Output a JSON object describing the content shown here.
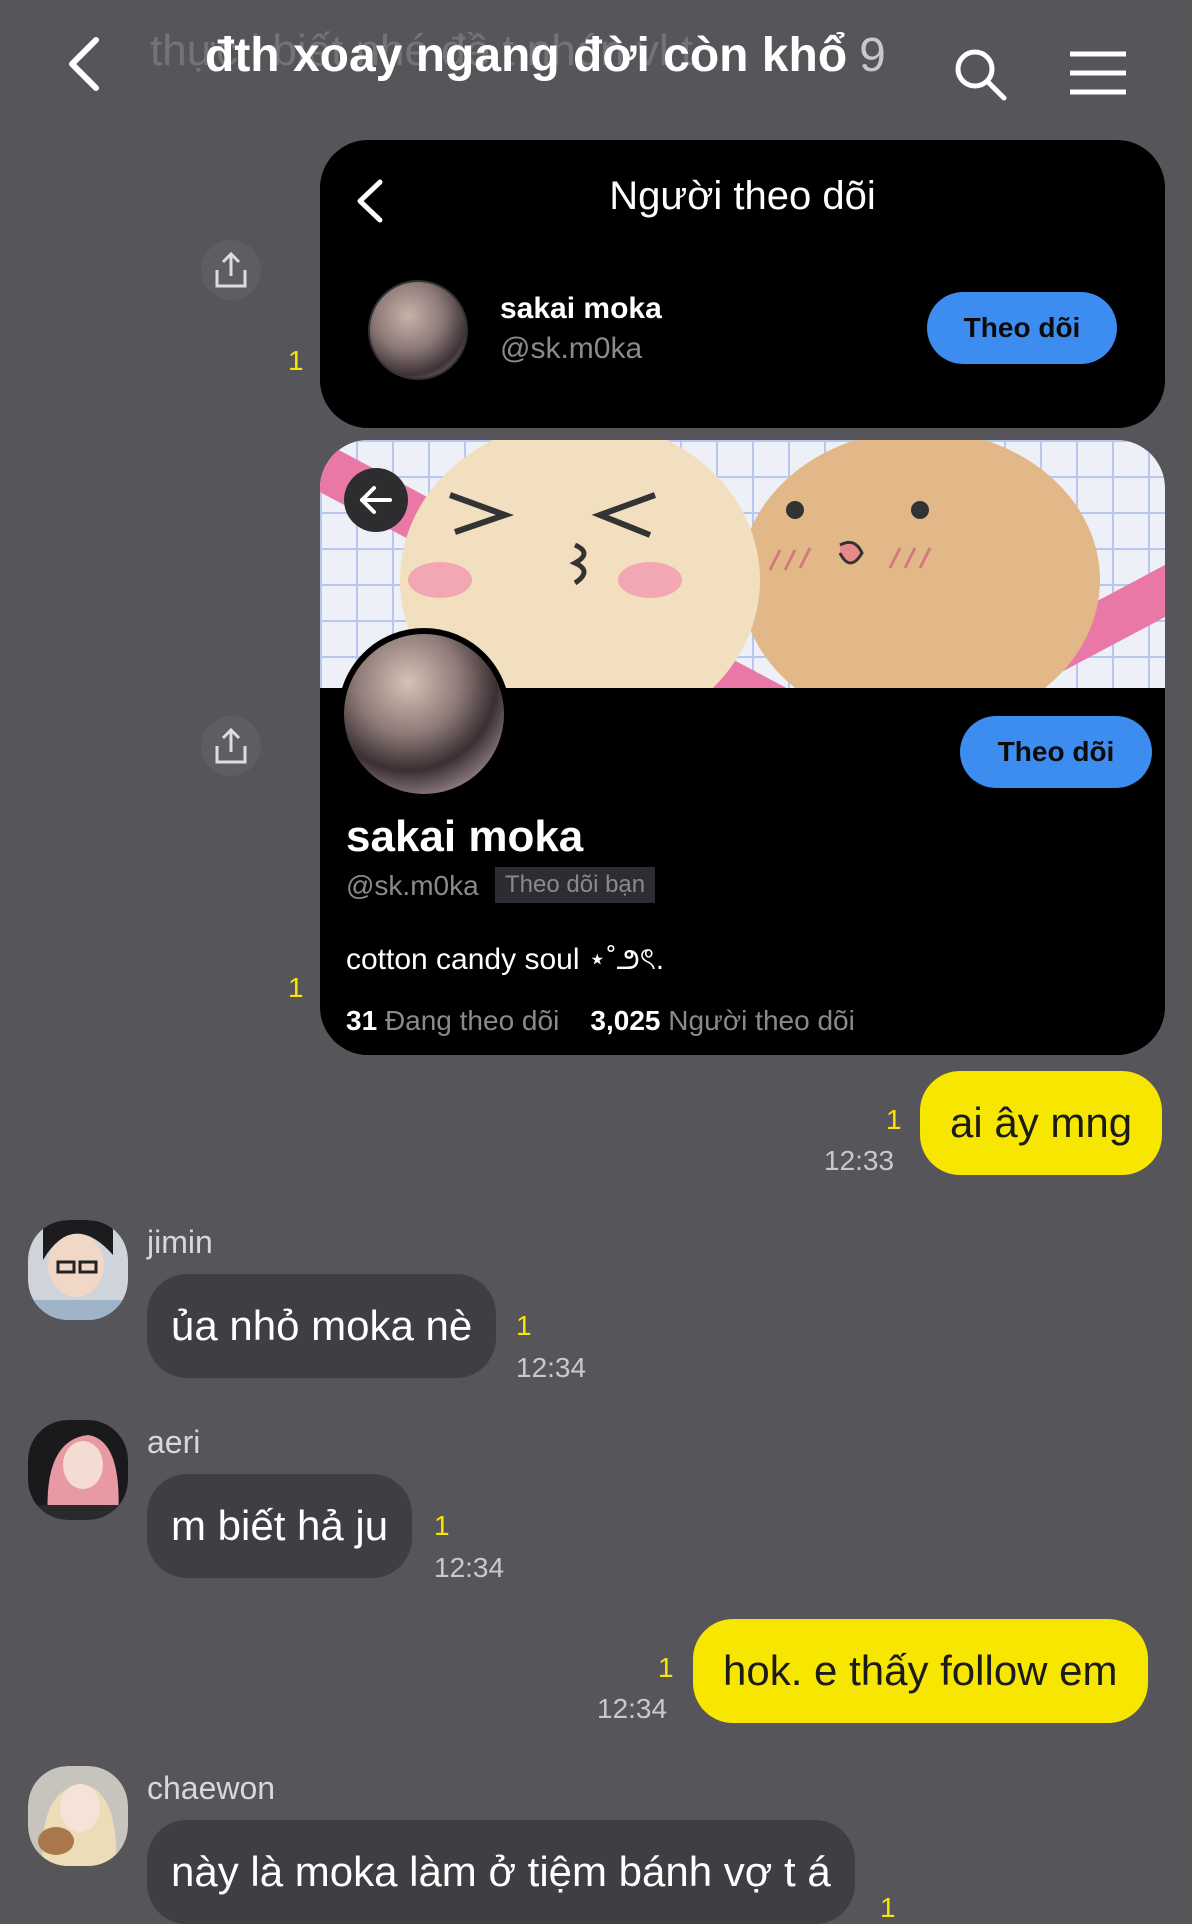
{
  "header": {
    "ghost_text": "thực i biết nhé đề t nhón vl t",
    "title": "đth xoay ngang đời còn khổ",
    "member_count": "9"
  },
  "card_followers": {
    "title": "Người theo dõi",
    "read_count": "1",
    "user": {
      "name": "sakai moka",
      "handle": "@sk.m0ka",
      "follow_label": "Theo dõi"
    }
  },
  "card_profile": {
    "read_count": "1",
    "follow_label": "Theo dõi",
    "name": "sakai moka",
    "handle": "@sk.m0ka",
    "follows_you": "Theo dõi bạn",
    "bio": "cotton candy soul ⋆˚౨ৎ.",
    "following_count": "31",
    "following_label": "Đang theo dõi",
    "followers_count": "3,025",
    "followers_label": "Người theo dõi"
  },
  "messages": [
    {
      "id": "m1",
      "direction": "out",
      "text": "ai ây mng",
      "read": "1",
      "time": "12:33"
    },
    {
      "id": "m2",
      "direction": "in",
      "sender": "jimin",
      "text": "ủa nhỏ moka nè",
      "read": "1",
      "time": "12:34"
    },
    {
      "id": "m3",
      "direction": "in",
      "sender": "aeri",
      "text": "m biết hả ju",
      "read": "1",
      "time": "12:34"
    },
    {
      "id": "m4",
      "direction": "out",
      "text": "hok. e thấy follow em",
      "read": "1",
      "time": "12:34"
    },
    {
      "id": "m5",
      "direction": "in",
      "sender": "chaewon",
      "text": "này là moka làm ở tiệm bánh vợ t á",
      "read": "1",
      "time": ""
    }
  ],
  "colors": {
    "background": "#56555a",
    "bubble_out": "#f7e600",
    "bubble_in": "#3f3f43",
    "follow_button": "#3d8cf0"
  }
}
